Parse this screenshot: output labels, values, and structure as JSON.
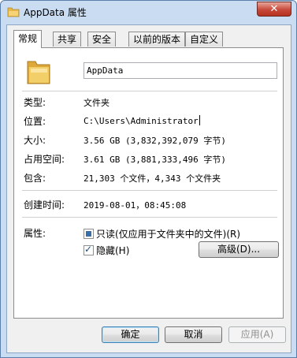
{
  "window": {
    "title": "AppData 属性",
    "close_label": "✕"
  },
  "tabs": [
    {
      "label": "常规",
      "active": true
    },
    {
      "label": "共享",
      "active": false
    },
    {
      "label": "安全",
      "active": false
    },
    {
      "label": "以前的版本",
      "active": false
    },
    {
      "label": "自定义",
      "active": false
    }
  ],
  "general": {
    "name_value": "AppData",
    "type_label": "类型:",
    "type_value": "文件夹",
    "location_label": "位置:",
    "location_value": "C:\\Users\\Administrator",
    "size_label": "大小:",
    "size_value": "3.56 GB (3,832,392,079 字节)",
    "size_on_disk_label": "占用空间:",
    "size_on_disk_value": "3.61 GB (3,881,333,496 字节)",
    "contains_label": "包含:",
    "contains_value": "21,303 个文件，4,343 个文件夹",
    "created_label": "创建时间:",
    "created_value": "2019-08-01，08:45:08",
    "attributes_label": "属性:",
    "readonly_label": "只读(仅应用于文件夹中的文件)(R)",
    "readonly_state": "indeterminate",
    "hidden_label": "隐藏(H)",
    "hidden_state": "checked",
    "advanced_label": "高级(D)..."
  },
  "footer": {
    "ok_label": "确定",
    "cancel_label": "取消",
    "apply_label": "应用(A)"
  },
  "colors": {
    "title_bg": "#c9dcf1",
    "close_red": "#c7493a",
    "panel_bg": "#ffffff",
    "dialog_bg": "#f0f0f0"
  }
}
